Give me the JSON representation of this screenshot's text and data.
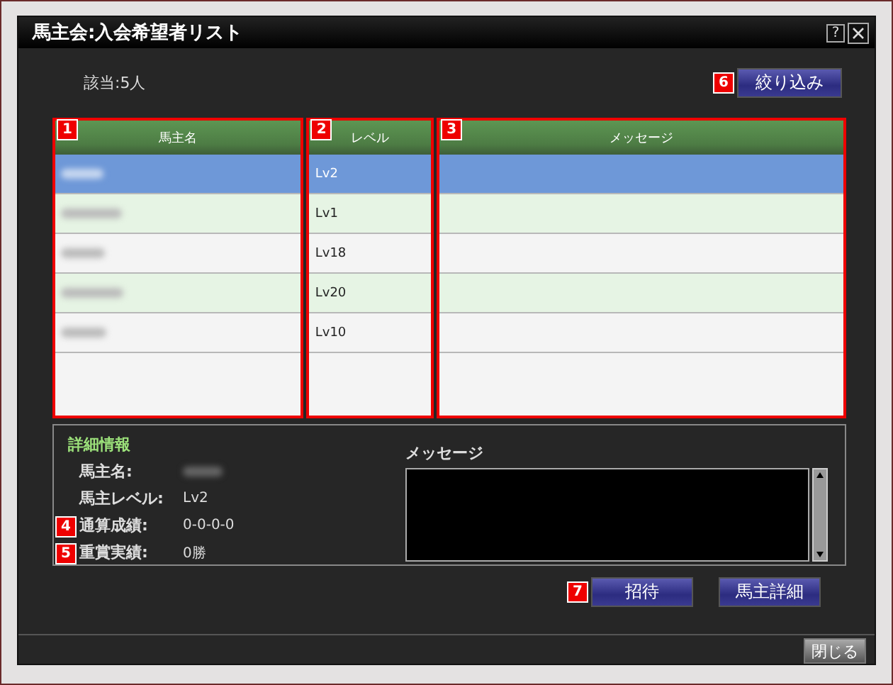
{
  "window": {
    "title": "馬主会:入会希望者リスト",
    "help_button": "?"
  },
  "count_label": "該当:5人",
  "filter_button": {
    "label": "絞り込み",
    "callout": "6"
  },
  "table": {
    "columns": [
      {
        "label": "馬主名",
        "callout": "1"
      },
      {
        "label": "レベル",
        "callout": "2"
      },
      {
        "label": "メッセージ",
        "callout": "3"
      }
    ],
    "rows": [
      {
        "owner_level": "Lv2",
        "selected": true
      },
      {
        "owner_level": "Lv1",
        "selected": false
      },
      {
        "owner_level": "Lv18",
        "selected": false
      },
      {
        "owner_level": "Lv20",
        "selected": false
      },
      {
        "owner_level": "Lv10",
        "selected": false
      }
    ]
  },
  "details": {
    "title": "詳細情報",
    "fields": [
      {
        "label": "馬主名:",
        "kind": "redacted"
      },
      {
        "label": "馬主レベル:",
        "kind": "text",
        "value": "Lv2"
      },
      {
        "label": "通算成績:",
        "kind": "text",
        "value": "0-0-0-0",
        "callout": "4"
      },
      {
        "label": "重賞実績:",
        "kind": "text",
        "value": "0勝",
        "callout": "5"
      }
    ],
    "message_label": "メッセージ"
  },
  "buttons": [
    {
      "label": "招待",
      "callout": "7"
    },
    {
      "label": "馬主詳細"
    }
  ],
  "close_button": "閉じる"
}
